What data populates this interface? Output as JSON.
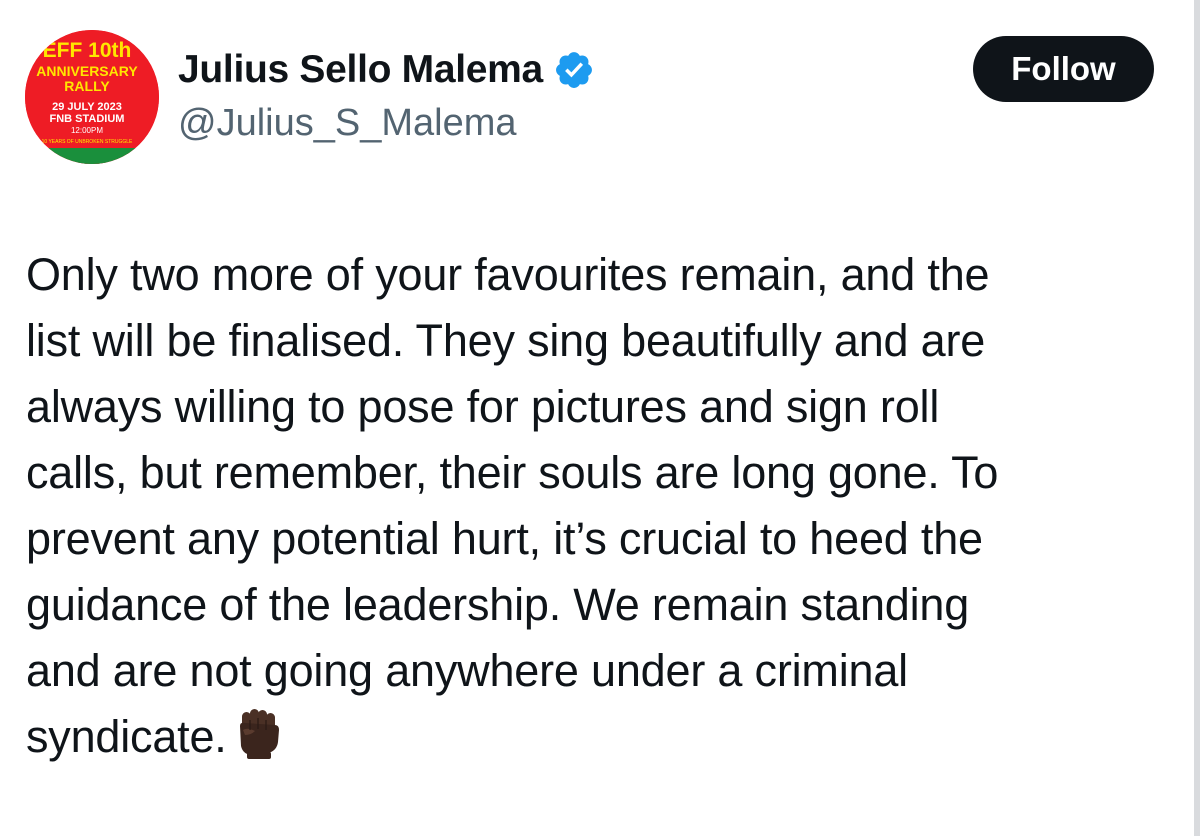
{
  "author": {
    "display_name": "Julius Sello Malema",
    "handle": "@Julius_S_Malema",
    "verified": true,
    "verified_icon": "verified-badge-icon",
    "avatar": {
      "line1": "EFF 10th",
      "line2": "ANNIVERSARY",
      "line3": "RALLY",
      "line4": "29 JULY 2023",
      "line5": "FNB STADIUM",
      "line6": "12:00PM",
      "line7": "10 YEARS OF UNBROKEN STRUGGLE"
    }
  },
  "actions": {
    "follow_label": "Follow"
  },
  "tweet": {
    "lines": [
      "Only two more of your favourites remain, and the",
      "list will be finalised. They sing beautifully and are",
      "always willing to pose for pictures and sign roll",
      "calls, but remember, their souls are long gone. To",
      "prevent any potential hurt, it’s crucial to heed the",
      "guidance of the leadership. We remain standing",
      "and are not going anywhere under a criminal",
      "syndicate."
    ],
    "emoji": "raised-fist-dark-skin-tone"
  },
  "colors": {
    "text": "#0f1419",
    "secondary": "#536471",
    "verified_blue": "#1d9bf0",
    "follow_bg": "#0f1419",
    "avatar_red": "#ee1c25",
    "avatar_yellow": "#ffe600"
  }
}
